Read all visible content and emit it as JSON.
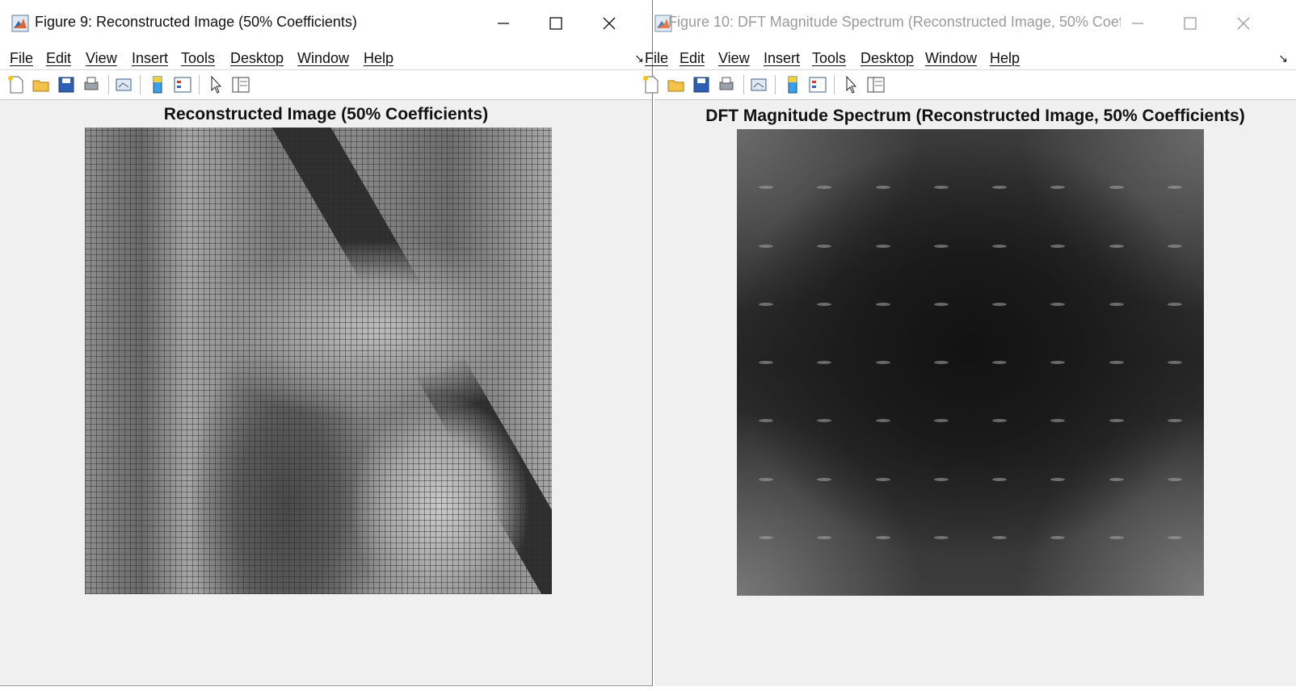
{
  "left_window": {
    "title": "Figure 9: Reconstructed Image (50% Coefficients)",
    "axes_title": "Reconstructed Image (50% Coefficients)",
    "image_alt": "Reconstructed grayscale portrait image"
  },
  "right_window": {
    "title": "Figure 10: DFT Magnitude Spectrum (Reconstructed Image, 50% Coeffic...",
    "axes_title": "DFT Magnitude Spectrum (Reconstructed Image, 50% Coefficients)",
    "image_alt": "DFT magnitude spectrum image"
  },
  "menu": [
    "File",
    "Edit",
    "View",
    "Insert",
    "Tools",
    "Desktop",
    "Window",
    "Help"
  ],
  "window_controls": [
    "minimize-icon",
    "maximize-icon",
    "close-icon"
  ],
  "toolbar_icons": [
    "new-figure-icon",
    "open-file-icon",
    "save-icon",
    "print-icon",
    "link-plot-icon",
    "insert-colorbar-icon",
    "insert-legend-icon",
    "edit-plot-icon",
    "property-inspector-icon"
  ],
  "colors": {
    "window_bg": "#f0f0f0",
    "titlebar_bg": "#ffffff",
    "inactive_title": "#9b9b9b",
    "matlab_orange": "#e1642a"
  }
}
